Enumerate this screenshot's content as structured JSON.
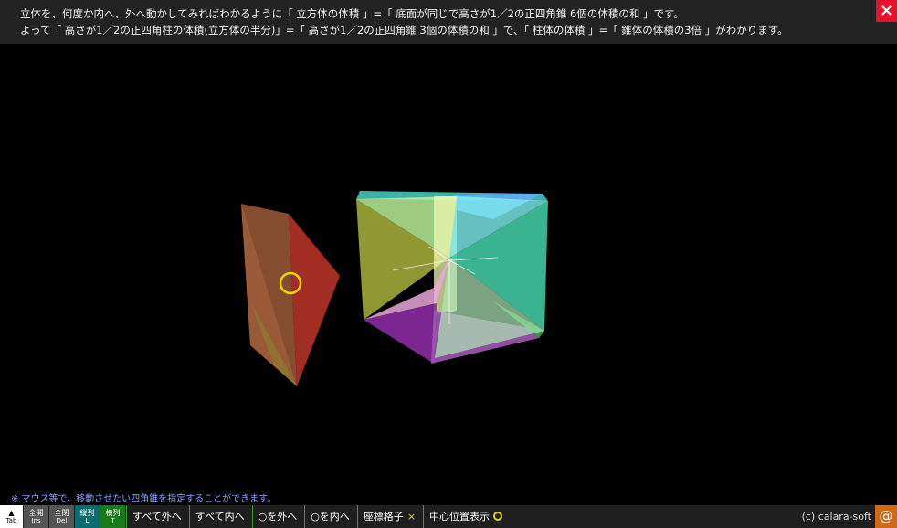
{
  "header": {
    "line1": "立体を、何度か内へ、外へ動かしてみればわかるように「 立方体の体積 」=「 底面が同じで高さが1／2の正四角錐  6個の体積の和 」です。",
    "line2": "よって「 高さが1／2の正四角柱の体積(立方体の半分)」=「 高さが1／2の正四角錐  3個の体積の和 」で、「 柱体の体積 」=「 錐体の体積の3倍 」がわかります。"
  },
  "close_icon": "×",
  "hint": "※ マウス等で、移動させたい四角錐を指定することができます。",
  "toolbar": {
    "tab": {
      "icon": "▲",
      "label": "Tab"
    },
    "all_open": {
      "label": "全開",
      "key": "Ins"
    },
    "all_close": {
      "label": "全閉",
      "key": "Del"
    },
    "vertical": {
      "label": "縦列",
      "key": "L"
    },
    "horizontal": {
      "label": "横列",
      "key": "T"
    },
    "all_out": "すべて外へ",
    "all_in": "すべて内へ",
    "circle_out": "○を外へ",
    "circle_in": "○を内へ",
    "grid": "座標格子",
    "grid_mark": "×",
    "center": "中心位置表示"
  },
  "copyright": "(c) calara-soft",
  "at_icon": "@",
  "colors": {
    "close_bg": "#e8112d",
    "selector_ring": "#e8d800",
    "at_bg": "#d06a16"
  }
}
